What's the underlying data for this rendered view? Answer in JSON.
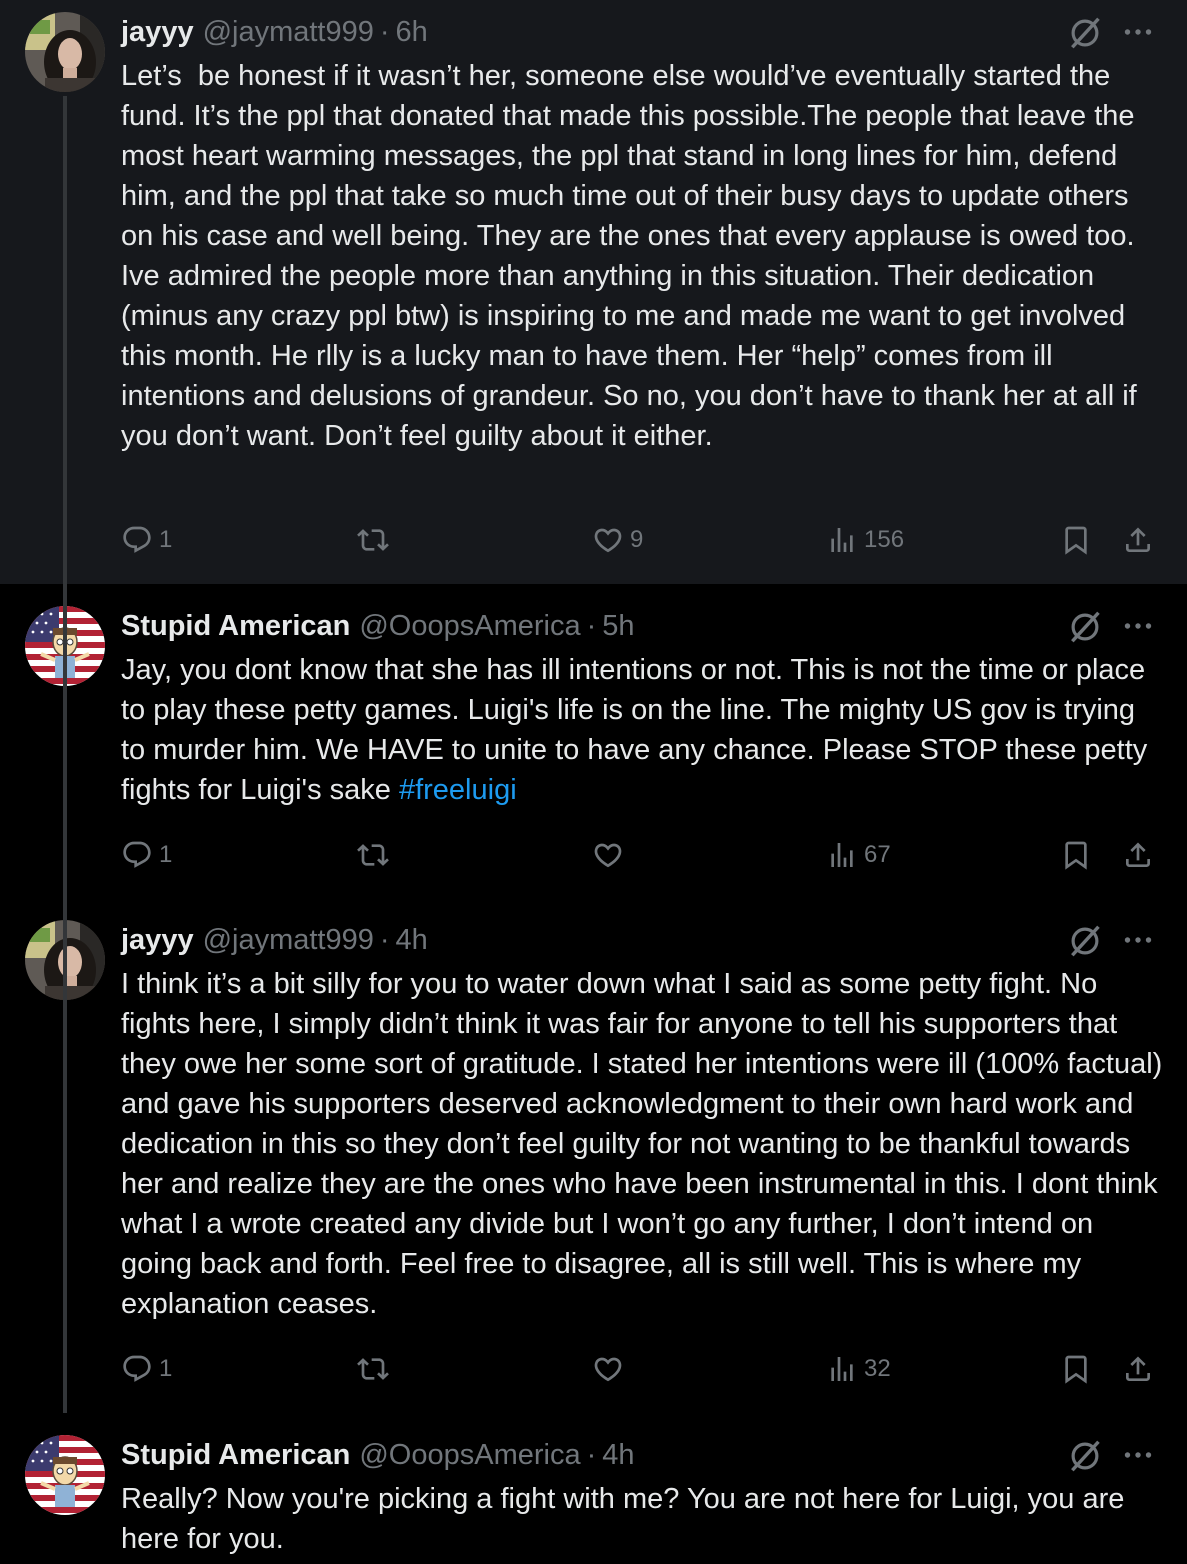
{
  "colors": {
    "background": "#000000",
    "highlight_background": "#16181c",
    "text": "#e7e9ea",
    "muted": "#71767b",
    "link": "#1d9bf0"
  },
  "tweets": [
    {
      "name": "jayyy",
      "handle": "@jaymatt999",
      "separator": "·",
      "time": "6h",
      "avatar_icon": "profile-photo",
      "text": "Let’s  be honest if it wasn’t her, someone else would’ve eventually started the fund. It’s the ppl that donated that made this possible.The people that leave the most heart warming messages, the ppl that stand in long lines for him, defend him, and the ppl that take so much time out of their busy days to update others on his case and well being. They are the ones that every applause is owed too. Ive admired the people more than anything in this situation. Their dedication (minus any crazy ppl btw) is inspiring to me and made me want to get involved this month. He rlly is a lucky man to have them. Her “help” comes from ill intentions and delusions of grandeur. So no, you don’t have to thank her at all if you don’t want. Don’t feel guilty about it either.",
      "hashtag": "",
      "replies": "1",
      "retweets": "",
      "likes": "9",
      "views": "156"
    },
    {
      "name": "Stupid American",
      "handle": "@OoopsAmerica",
      "separator": "·",
      "time": "5h",
      "avatar_icon": "us-flag-avatar",
      "text": "Jay, you dont know that she has ill intentions or not. This is not the time or place to play these petty games. Luigi's life is on the line. The mighty US gov is trying to murder him. We HAVE to unite to have any chance. Please STOP these petty fights for Luigi's sake ",
      "hashtag": "#freeluigi",
      "replies": "1",
      "retweets": "",
      "likes": "",
      "views": "67"
    },
    {
      "name": "jayyy",
      "handle": "@jaymatt999",
      "separator": "·",
      "time": "4h",
      "avatar_icon": "profile-photo",
      "text": "I think it’s a bit silly for you to water down what I said as some petty fight. No fights here, I simply didn’t think it was fair for anyone to tell his supporters that they owe her some sort of gratitude. I stated her intentions were ill (100% factual) and gave his supporters deserved acknowledgment to their own hard work and dedication in this so they don’t feel guilty for not wanting to be thankful towards her and realize they are the ones who have been instrumental in this. I dont think what I a wrote created any divide but I won’t go any further, I don’t intend on going back and forth. Feel free to disagree, all is still well. This is where my explanation ceases.",
      "hashtag": "",
      "replies": "1",
      "retweets": "",
      "likes": "",
      "views": "32"
    },
    {
      "name": "Stupid American",
      "handle": "@OoopsAmerica",
      "separator": "·",
      "time": "4h",
      "avatar_icon": "us-flag-avatar",
      "text": "Really? Now you're picking a fight with me? You are not here for Luigi, you are here for you.",
      "hashtag": "",
      "replies": "",
      "retweets": "",
      "likes": "",
      "views": ""
    }
  ],
  "icons": {
    "reply": "reply-icon",
    "retweet": "retweet-icon",
    "like": "heart-icon",
    "views": "views-icon",
    "bookmark": "bookmark-icon",
    "share": "share-icon",
    "grok": "grok-icon",
    "more": "more-icon"
  }
}
